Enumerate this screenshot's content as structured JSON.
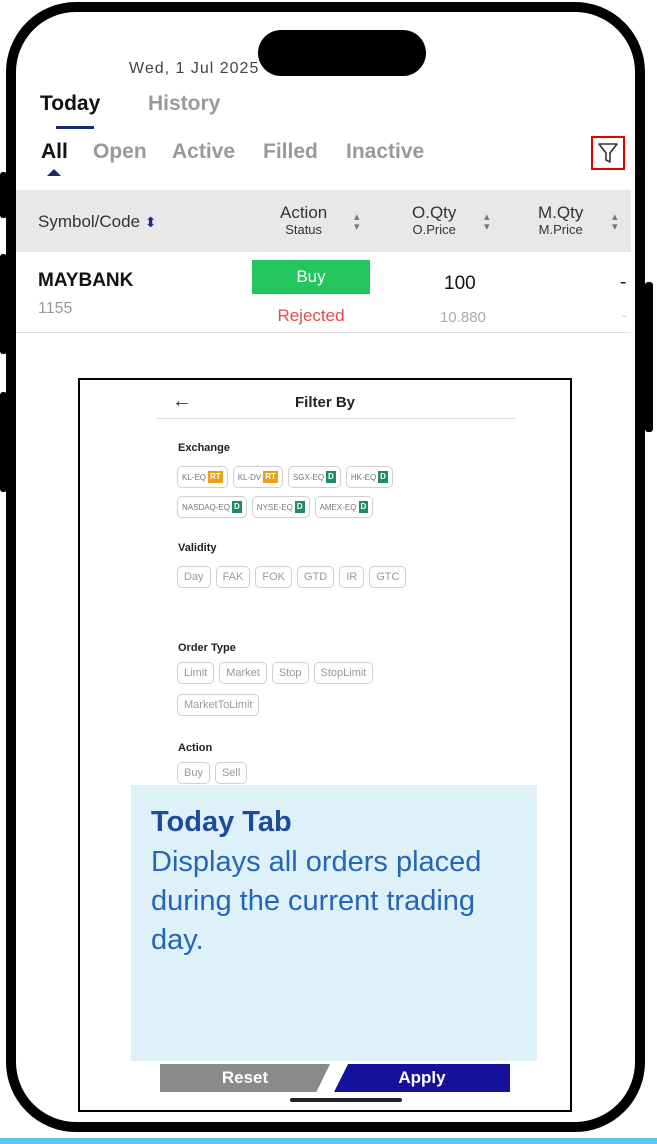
{
  "status_bar": {
    "clipped_text": "Wed, 1 Jul 2025"
  },
  "main_tabs": {
    "today": "Today",
    "history": "History"
  },
  "status_tabs": {
    "all": "All",
    "open": "Open",
    "active": "Active",
    "filled": "Filled",
    "inactive": "Inactive"
  },
  "table_header": {
    "symbol": "Symbol/Code",
    "action": "Action",
    "action_sub": "Status",
    "oqty": "O.Qty",
    "oqty_sub": "O.Price",
    "mqty": "M.Qty",
    "mqty_sub": "M.Price"
  },
  "order": {
    "symbol": "MAYBANK",
    "code": "1155",
    "action": "Buy",
    "status": "Rejected",
    "oqty": "100",
    "oprice": "10.880",
    "mqty": "-",
    "mprice": "-"
  },
  "filter": {
    "title": "Filter By",
    "back_icon": "arrow-left-icon",
    "exchange_title": "Exchange",
    "exchanges_row1": [
      {
        "label": "KL-EQ",
        "tag": "RT"
      },
      {
        "label": "KL-DV",
        "tag": "RT"
      },
      {
        "label": "SGX-EQ",
        "tag": "D"
      },
      {
        "label": "HK-EQ",
        "tag": "D"
      }
    ],
    "exchanges_row2": [
      {
        "label": "NASDAQ-EQ",
        "tag": "D"
      },
      {
        "label": "NYSE-EQ",
        "tag": "D"
      },
      {
        "label": "AMEX-EQ",
        "tag": "D"
      }
    ],
    "validity_title": "Validity",
    "validity": [
      "Day",
      "FAK",
      "FOK",
      "GTD",
      "IR",
      "GTC"
    ],
    "order_type_title": "Order Type",
    "order_types_row1": [
      "Limit",
      "Market",
      "Stop",
      "StopLimit"
    ],
    "order_types_row2": [
      "MarketToLimit"
    ],
    "action_title": "Action",
    "actions": [
      "Buy",
      "Sell"
    ],
    "reset": "Reset",
    "apply": "Apply"
  },
  "callout": {
    "title": "Today Tab",
    "body": "Displays all orders placed during the current trading day."
  },
  "colors": {
    "buy": "#22c55e",
    "rejected": "#e5484d",
    "apply": "#15119a",
    "reset": "#8a8a8a",
    "callout_bg": "#dff1f8",
    "callout_text": "#2466b8",
    "filter_highlight": "#e00000",
    "tag_rt": "#e8a21a",
    "tag_d": "#1f8a6e"
  }
}
